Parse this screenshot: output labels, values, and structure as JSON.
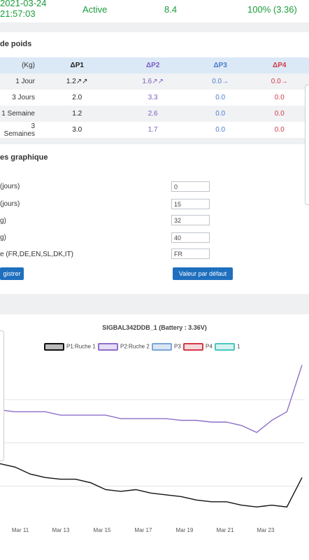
{
  "status": {
    "date": "2021-03-24",
    "time": "21:57:03",
    "state": "Active",
    "temperature": "8.4",
    "battery": "100% (3.36)"
  },
  "weights": {
    "title": "de poids",
    "headers": [
      "(Kg)",
      "ΔP1",
      "ΔP2",
      "ΔP3",
      "ΔP4"
    ],
    "rows": [
      {
        "label": "1 Jour",
        "p1": "1.2↗↗",
        "p2": "1.6↗↗",
        "p3": "0.0→",
        "p4": "0.0→"
      },
      {
        "label": "3 Jours",
        "p1": "2.0",
        "p2": "3.3",
        "p3": "0.0",
        "p4": "0.0"
      },
      {
        "label": "1 Semaine",
        "p1": "1.2",
        "p2": "2.6",
        "p3": "0.0",
        "p4": "0.0"
      },
      {
        "label": "3 Semaines",
        "p1": "3.0",
        "p2": "1.7",
        "p3": "0.0",
        "p4": "0.0"
      }
    ]
  },
  "params": {
    "title": "es graphique",
    "fields": [
      {
        "label": "(jours)",
        "value": "0"
      },
      {
        "label": "(jours)",
        "value": "15"
      },
      {
        "label": "g)",
        "value": "32"
      },
      {
        "label": "g)",
        "value": "40"
      },
      {
        "label": "e (FR,DE,EN,SL,DK,IT)",
        "value": "FR"
      }
    ],
    "save_label": "gistrer",
    "default_label": "Valeur par défaut"
  },
  "chart_data": {
    "type": "line",
    "title": "SIGBAL342DDB_1   (Battery : 3.36V)",
    "legend": [
      "P1:Ruche 1",
      "P2:Ruche 2",
      "P3",
      "P4",
      "1"
    ],
    "legend_colors": [
      "#111111",
      "#8e6fc9",
      "#7aa6d8",
      "#d23a4a",
      "#49c6c0"
    ],
    "x_ticks": [
      "Mar 11",
      "Mar 13",
      "Mar 15",
      "Mar 17",
      "Mar 19",
      "Mar 21",
      "Mar 23"
    ],
    "series": [
      {
        "name": "P1:Ruche 1",
        "values": [
          36.8,
          36.6,
          36.2,
          36.0,
          35.9,
          35.9,
          35.7,
          35.3,
          35.2,
          35.3,
          35.1,
          35.0,
          34.9,
          34.7,
          34.6,
          34.6,
          34.4,
          34.3,
          34.4,
          34.3,
          36.0
        ]
      },
      {
        "name": "P2:Ruche 2",
        "values": [
          39.9,
          39.8,
          39.8,
          39.8,
          39.6,
          39.6,
          39.6,
          39.6,
          39.4,
          39.4,
          39.4,
          39.4,
          39.3,
          39.3,
          39.2,
          39.2,
          39.0,
          38.6,
          39.3,
          39.8,
          42.5
        ]
      }
    ]
  }
}
